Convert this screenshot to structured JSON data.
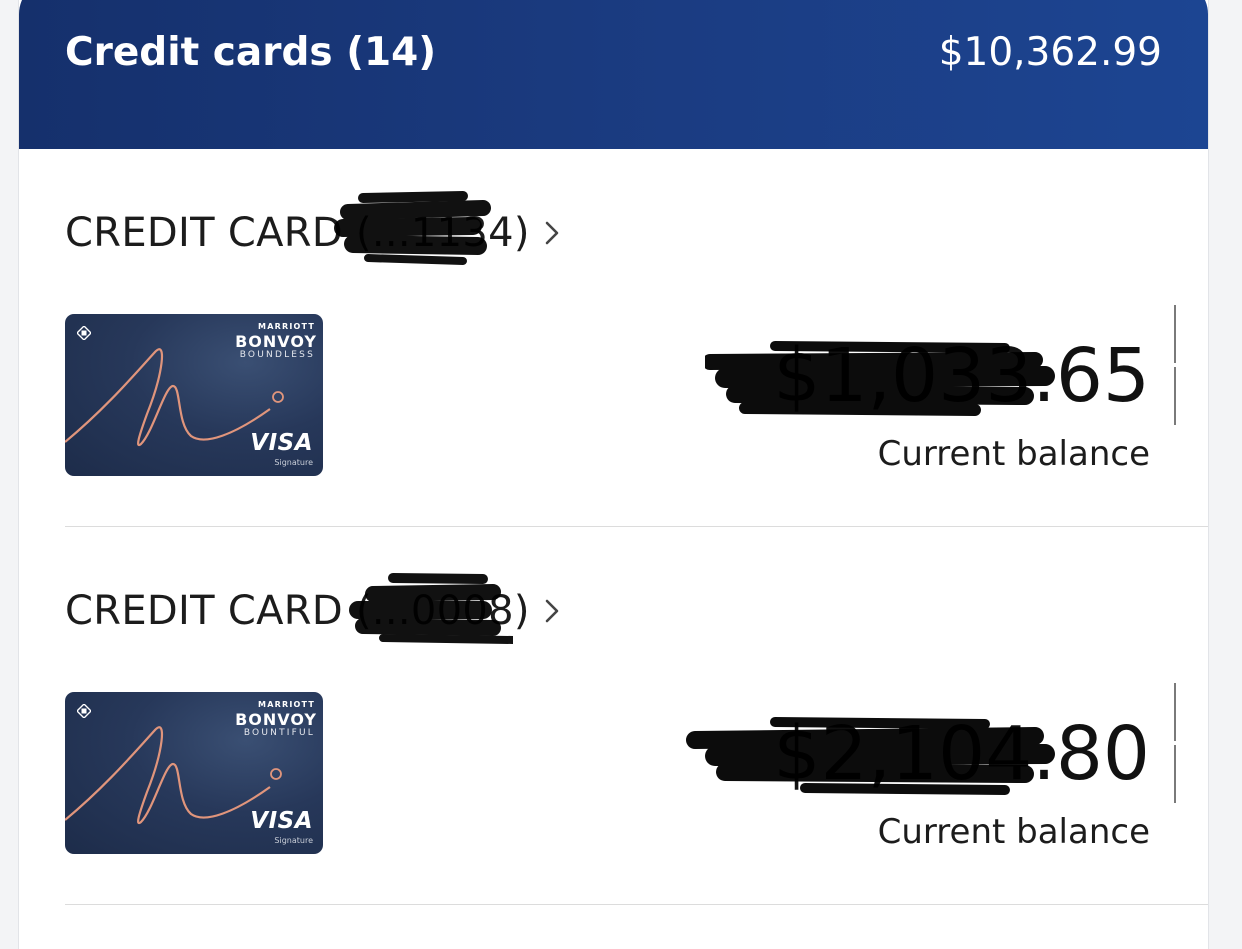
{
  "header": {
    "title": "Credit cards (14)",
    "total": "$10,362.99"
  },
  "accounts": [
    {
      "name": "CREDIT CARD (...1134)",
      "card": {
        "brand_small": "MARRIOTT",
        "brand_big": "BONVOY",
        "brand_sub": "BOUNDLESS",
        "network": "VISA",
        "network_sub": "Signature"
      },
      "balance": "$1,033.65",
      "balance_label": "Current balance"
    },
    {
      "name": "CREDIT CARD (...0008)",
      "card": {
        "brand_small": "MARRIOTT",
        "brand_big": "BONVOY",
        "brand_sub": "BOUNTIFUL",
        "network": "VISA",
        "network_sub": "Signature"
      },
      "balance": "$2,104.80",
      "balance_label": "Current balance"
    }
  ],
  "colors": {
    "header_start": "#15306c",
    "header_end": "#1c4592",
    "card_bg": "#27385a",
    "swirl": "#e0957c",
    "redaction": "#000000"
  },
  "icons": {
    "chevron": "chevron-right-icon",
    "bank_logo": "bank-logo-icon"
  }
}
